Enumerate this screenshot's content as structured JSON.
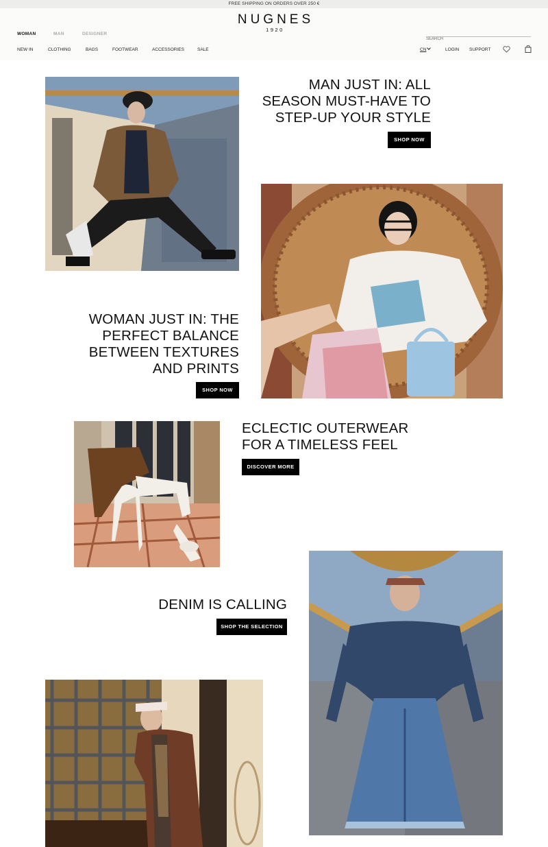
{
  "promo_bar": {
    "text": "FREE SHIPPING ON ORDERS OVER 250 €"
  },
  "header": {
    "logo": {
      "name": "NUGNES",
      "year": "1920"
    },
    "gender_nav": [
      {
        "label": "WOMAN",
        "active": true
      },
      {
        "label": "MAN",
        "active": false
      },
      {
        "label": "DESIGNER",
        "active": false
      }
    ],
    "search": {
      "label": "SEARCH",
      "value": ""
    },
    "categories": [
      "NEW IN",
      "CLOTHING",
      "BAGS",
      "FOOTWEAR",
      "ACCESSORIES",
      "SALE"
    ],
    "language": "CN",
    "login": "LOGIN",
    "support": "SUPPORT",
    "icons": {
      "wishlist": "heart-icon",
      "cart": "shopping-bag-icon",
      "lang_dropdown": "chevron-down-icon"
    }
  },
  "blocks": [
    {
      "title": "MAN JUST IN: ALL SEASON MUST-HAVE TO STEP-UP YOUR STYLE",
      "lines": [
        "MAN JUST IN: ALL",
        "SEASON MUST-HAVE TO",
        "STEP-UP YOUR STYLE"
      ],
      "cta": "SHOP NOW"
    },
    {
      "title": "WOMAN JUST IN: THE PERFECT BALANCE BETWEEN TEXTURES AND PRINTS",
      "lines": [
        "WOMAN JUST IN: THE",
        "PERFECT BALANCE",
        "BETWEEN TEXTURES",
        "AND PRINTS"
      ],
      "cta": "SHOP NOW"
    },
    {
      "title": "ECLECTIC OUTERWEAR FOR A TIMELESS FEEL",
      "lines": [
        "ECLECTIC OUTERWEAR",
        "FOR A TIMELESS FEEL"
      ],
      "cta": "DISCOVER MORE"
    },
    {
      "title": "DENIM IS CALLING",
      "lines": [
        "DENIM IS CALLING"
      ],
      "cta": "SHOP THE SELECTION"
    }
  ],
  "colors": {
    "cta_bg": "#000000",
    "cta_text": "#ffffff",
    "promo_bg": "#ededeb",
    "header_bg": "#fbfbfa"
  }
}
